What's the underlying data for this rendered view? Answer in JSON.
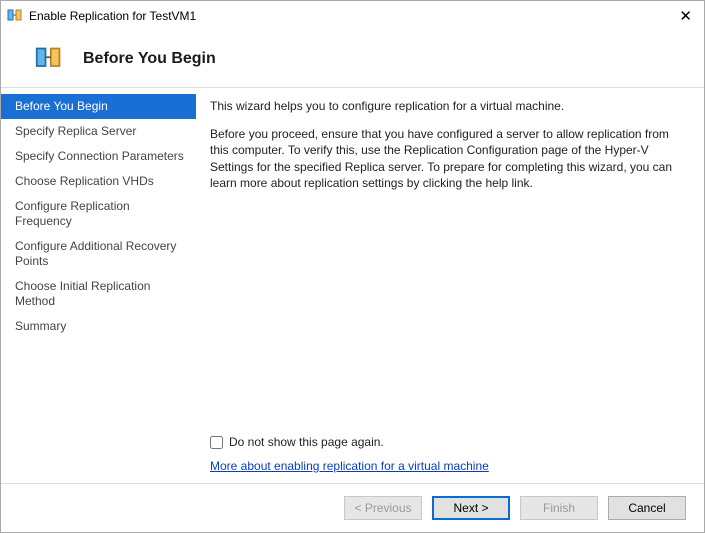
{
  "window": {
    "title": "Enable Replication for TestVM1"
  },
  "header": {
    "title": "Before You Begin"
  },
  "sidebar": {
    "items": [
      {
        "label": "Before You Begin",
        "selected": true
      },
      {
        "label": "Specify Replica Server",
        "selected": false
      },
      {
        "label": "Specify Connection Parameters",
        "selected": false
      },
      {
        "label": "Choose Replication VHDs",
        "selected": false
      },
      {
        "label": "Configure Replication Frequency",
        "selected": false
      },
      {
        "label": "Configure Additional Recovery Points",
        "selected": false
      },
      {
        "label": "Choose Initial Replication Method",
        "selected": false
      },
      {
        "label": "Summary",
        "selected": false
      }
    ]
  },
  "content": {
    "intro": "This wizard helps you to configure replication for a virtual machine.",
    "body": "Before you proceed, ensure that you have configured a server to allow replication from this computer. To verify this, use the Replication Configuration page of the Hyper-V Settings for the specified Replica server. To prepare for completing this wizard, you can learn more about replication settings by clicking the help link.",
    "checkbox_label": "Do not show this page again.",
    "help_link": "More about enabling replication for a virtual machine"
  },
  "footer": {
    "previous": "< Previous",
    "next": "Next >",
    "finish": "Finish",
    "cancel": "Cancel"
  }
}
